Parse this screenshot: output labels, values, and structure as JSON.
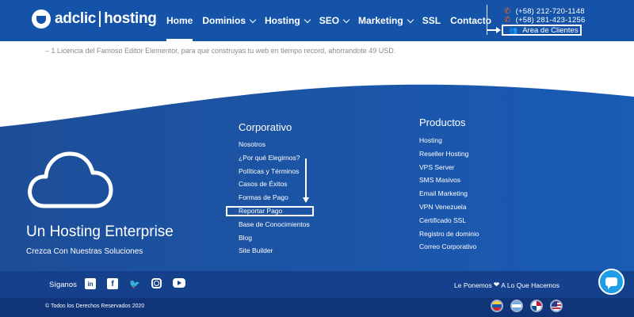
{
  "header": {
    "logo": {
      "left": "adclic",
      "right": "hosting"
    },
    "nav": [
      {
        "label": "Home",
        "active": true,
        "dropdown": false
      },
      {
        "label": "Dominios",
        "active": false,
        "dropdown": true
      },
      {
        "label": "Hosting",
        "active": false,
        "dropdown": true
      },
      {
        "label": "SEO",
        "active": false,
        "dropdown": true
      },
      {
        "label": "Marketing",
        "active": false,
        "dropdown": true
      },
      {
        "label": "SSL",
        "active": false,
        "dropdown": false
      },
      {
        "label": "Contacto",
        "active": false,
        "dropdown": false
      }
    ],
    "phones": [
      "(+58) 212-720-1148",
      "(+58) 281-423-1256"
    ],
    "client_area": "Area de Clientes"
  },
  "intro_text": "– 1 Licencia del Famoso Editor Elementor, para que construyas tu web en tiempo record, ahorrandote 49 USD.",
  "footer": {
    "brand_title": "Un Hosting Enterprise",
    "brand_subtitle": "Crezca Con Nuestras Soluciones",
    "corporativo": {
      "title": "Corporativo",
      "links": [
        "Nosotros",
        "¿Por qué Elegirnos?",
        "Políticas y Términos",
        "Casos de Éxitos",
        "Formas de Pago",
        "Reportar Pago",
        "Base de Conocimientos",
        "Blog",
        "Site Builder"
      ]
    },
    "productos": {
      "title": "Productos",
      "links": [
        "Hosting",
        "Reseller Hosting",
        "VPS Server",
        "SMS Masivos",
        "Email Marketing",
        "VPN Venezuela",
        "Certificado SSL",
        "Registro de dominio",
        "Correo Corporativo"
      ]
    },
    "follow_label": "Síganos",
    "social_icons": [
      "linkedin-icon",
      "facebook-icon",
      "twitter-icon",
      "instagram-icon",
      "youtube-icon"
    ],
    "tagline_before": "Le Ponemos",
    "tagline_after": "A Lo Que Hacemos",
    "copyright": "© Todos los Derechos Reservados 2020",
    "flags": [
      "venezuela-flag-icon",
      "argentina-flag-icon",
      "panama-flag-icon",
      "usa-flag-icon"
    ]
  },
  "colors": {
    "header_blue": "#1453a8",
    "footer_blue": "#1b54a6",
    "social_bar": "#15418c",
    "bottom_bar": "#0f3477",
    "accent_orange": "#f0642b",
    "chat_blue": "#1e9ee8"
  }
}
